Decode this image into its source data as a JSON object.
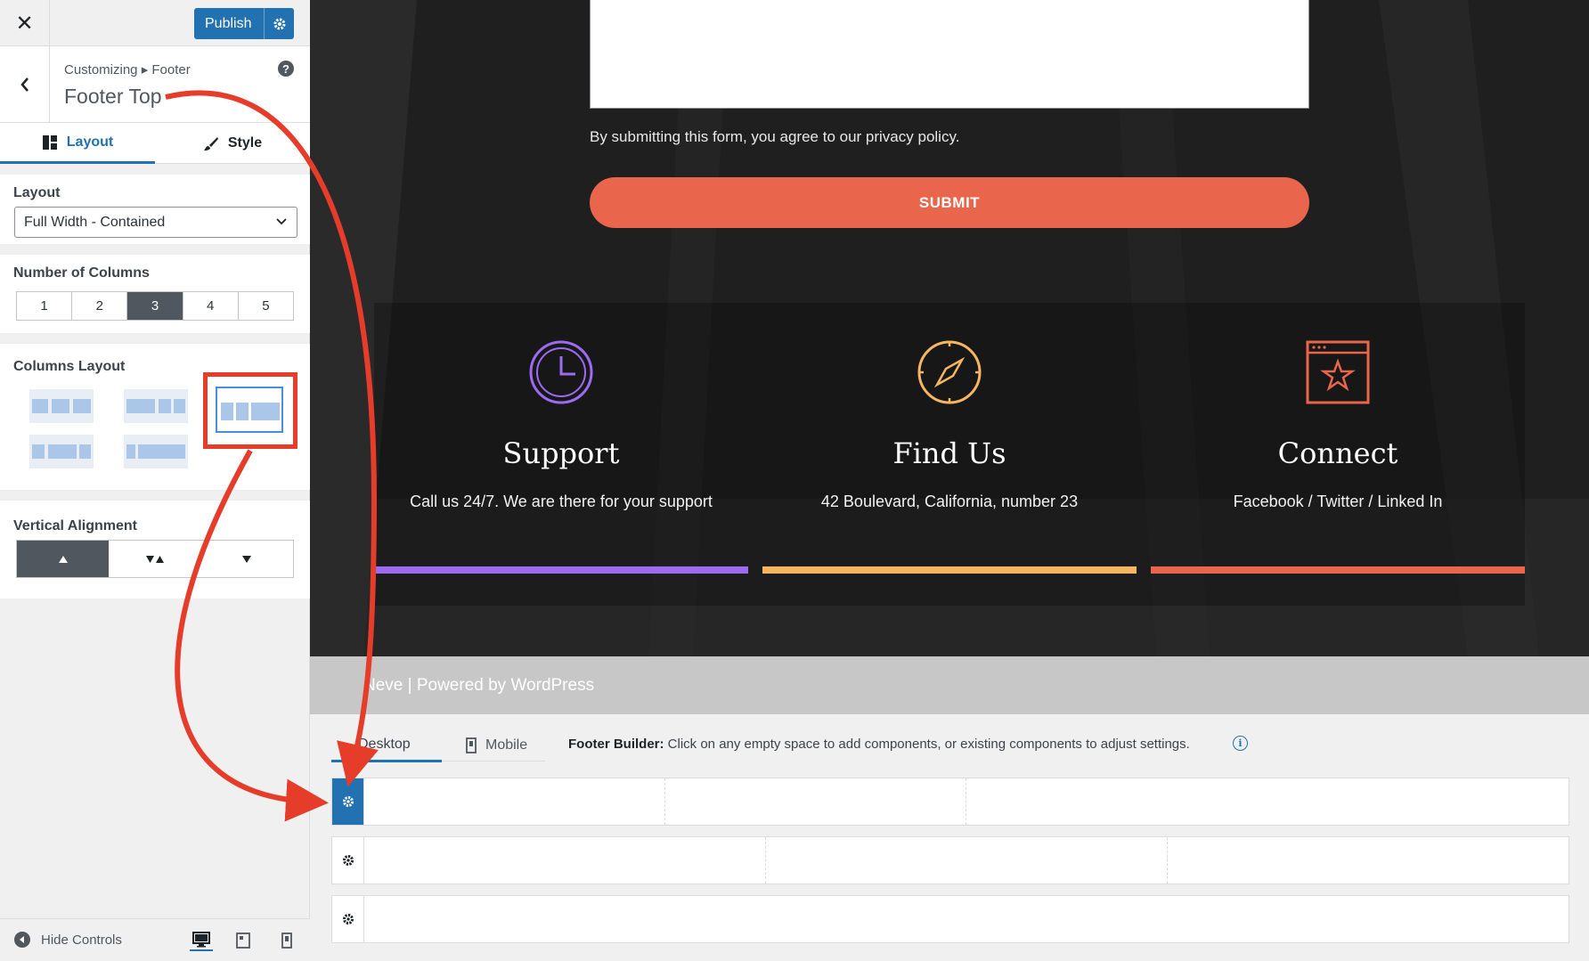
{
  "sidebar": {
    "close_symbol": "✕",
    "publish_label": "Publish",
    "breadcrumb": "Customizing ▸ Footer",
    "section_title": "Footer Top",
    "help_symbol": "?",
    "tabs": [
      {
        "label": "Layout",
        "icon": "layout-icon",
        "active": true
      },
      {
        "label": "Style",
        "icon": "brush-icon",
        "active": false
      }
    ],
    "layout_label": "Layout",
    "layout_select": "Full Width - Contained",
    "columns_label": "Number of Columns",
    "columns_options": [
      "1",
      "2",
      "3",
      "4",
      "5"
    ],
    "columns_selected": "3",
    "columns_layout_label": "Columns Layout",
    "vertical_alignment_label": "Vertical Alignment",
    "vertical_alignment_selected": "top",
    "hide_controls_label": "Hide Controls",
    "devices": [
      "desktop-icon",
      "tablet-icon",
      "mobile-icon"
    ]
  },
  "preview": {
    "privacy_text": "By submitting this form, you agree to our privacy policy.",
    "submit_label": "SUBMIT",
    "features": [
      {
        "title": "Support",
        "desc": "Call us 24/7. We are there for your support",
        "icon": "clock-icon",
        "color": "#9b6cf0"
      },
      {
        "title": "Find Us",
        "desc": "42 Boulevard, California, number 23",
        "icon": "compass-icon",
        "color": "#f5b561"
      },
      {
        "title": "Connect",
        "desc": "Facebook / Twitter / Linked In",
        "icon": "star-window-icon",
        "color": "#e9654b"
      }
    ],
    "credit": "Neve | Powered by WordPress"
  },
  "builder": {
    "tabs": [
      {
        "label": "Desktop",
        "active": true
      },
      {
        "label": "Mobile",
        "active": false
      }
    ],
    "info_bold": "Footer Builder:",
    "info_text": "Click on any empty space to add components, or existing components to adjust settings.",
    "info_symbol": "i",
    "rows": [
      {
        "name": "top",
        "columns": 3,
        "active": true
      },
      {
        "name": "main",
        "columns": 3,
        "active": false
      },
      {
        "name": "bottom",
        "columns": 1,
        "active": false
      }
    ]
  },
  "colors": {
    "accent": "#2271b1",
    "annotation": "#e63c2a",
    "submit": "#e9654b"
  }
}
